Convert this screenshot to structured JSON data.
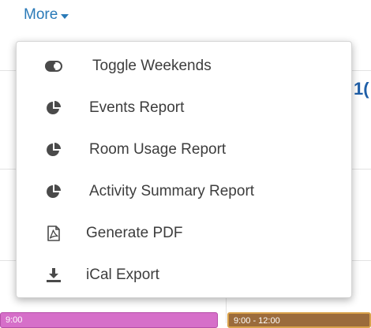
{
  "toggle": {
    "label": "More"
  },
  "menu": {
    "items": [
      {
        "label": "Toggle Weekends",
        "icon": "toggle-icon"
      },
      {
        "label": "Events Report",
        "icon": "pie-chart-icon"
      },
      {
        "label": "Room Usage Report",
        "icon": "pie-chart-icon"
      },
      {
        "label": "Activity Summary Report",
        "icon": "pie-chart-icon"
      },
      {
        "label": "Generate PDF",
        "icon": "pdf-file-icon"
      },
      {
        "label": "iCal Export",
        "icon": "download-icon"
      }
    ]
  },
  "background": {
    "day_number": "1(",
    "event_left_time": "9:00",
    "event_right_time": "9:00 - 12:00"
  },
  "colors": {
    "accent": "#2a7ab8",
    "menu_text": "#3d3d3d",
    "icon": "#4a4a4a",
    "event_pink": "#d66fc9",
    "event_brown": "#9b6b3c"
  }
}
